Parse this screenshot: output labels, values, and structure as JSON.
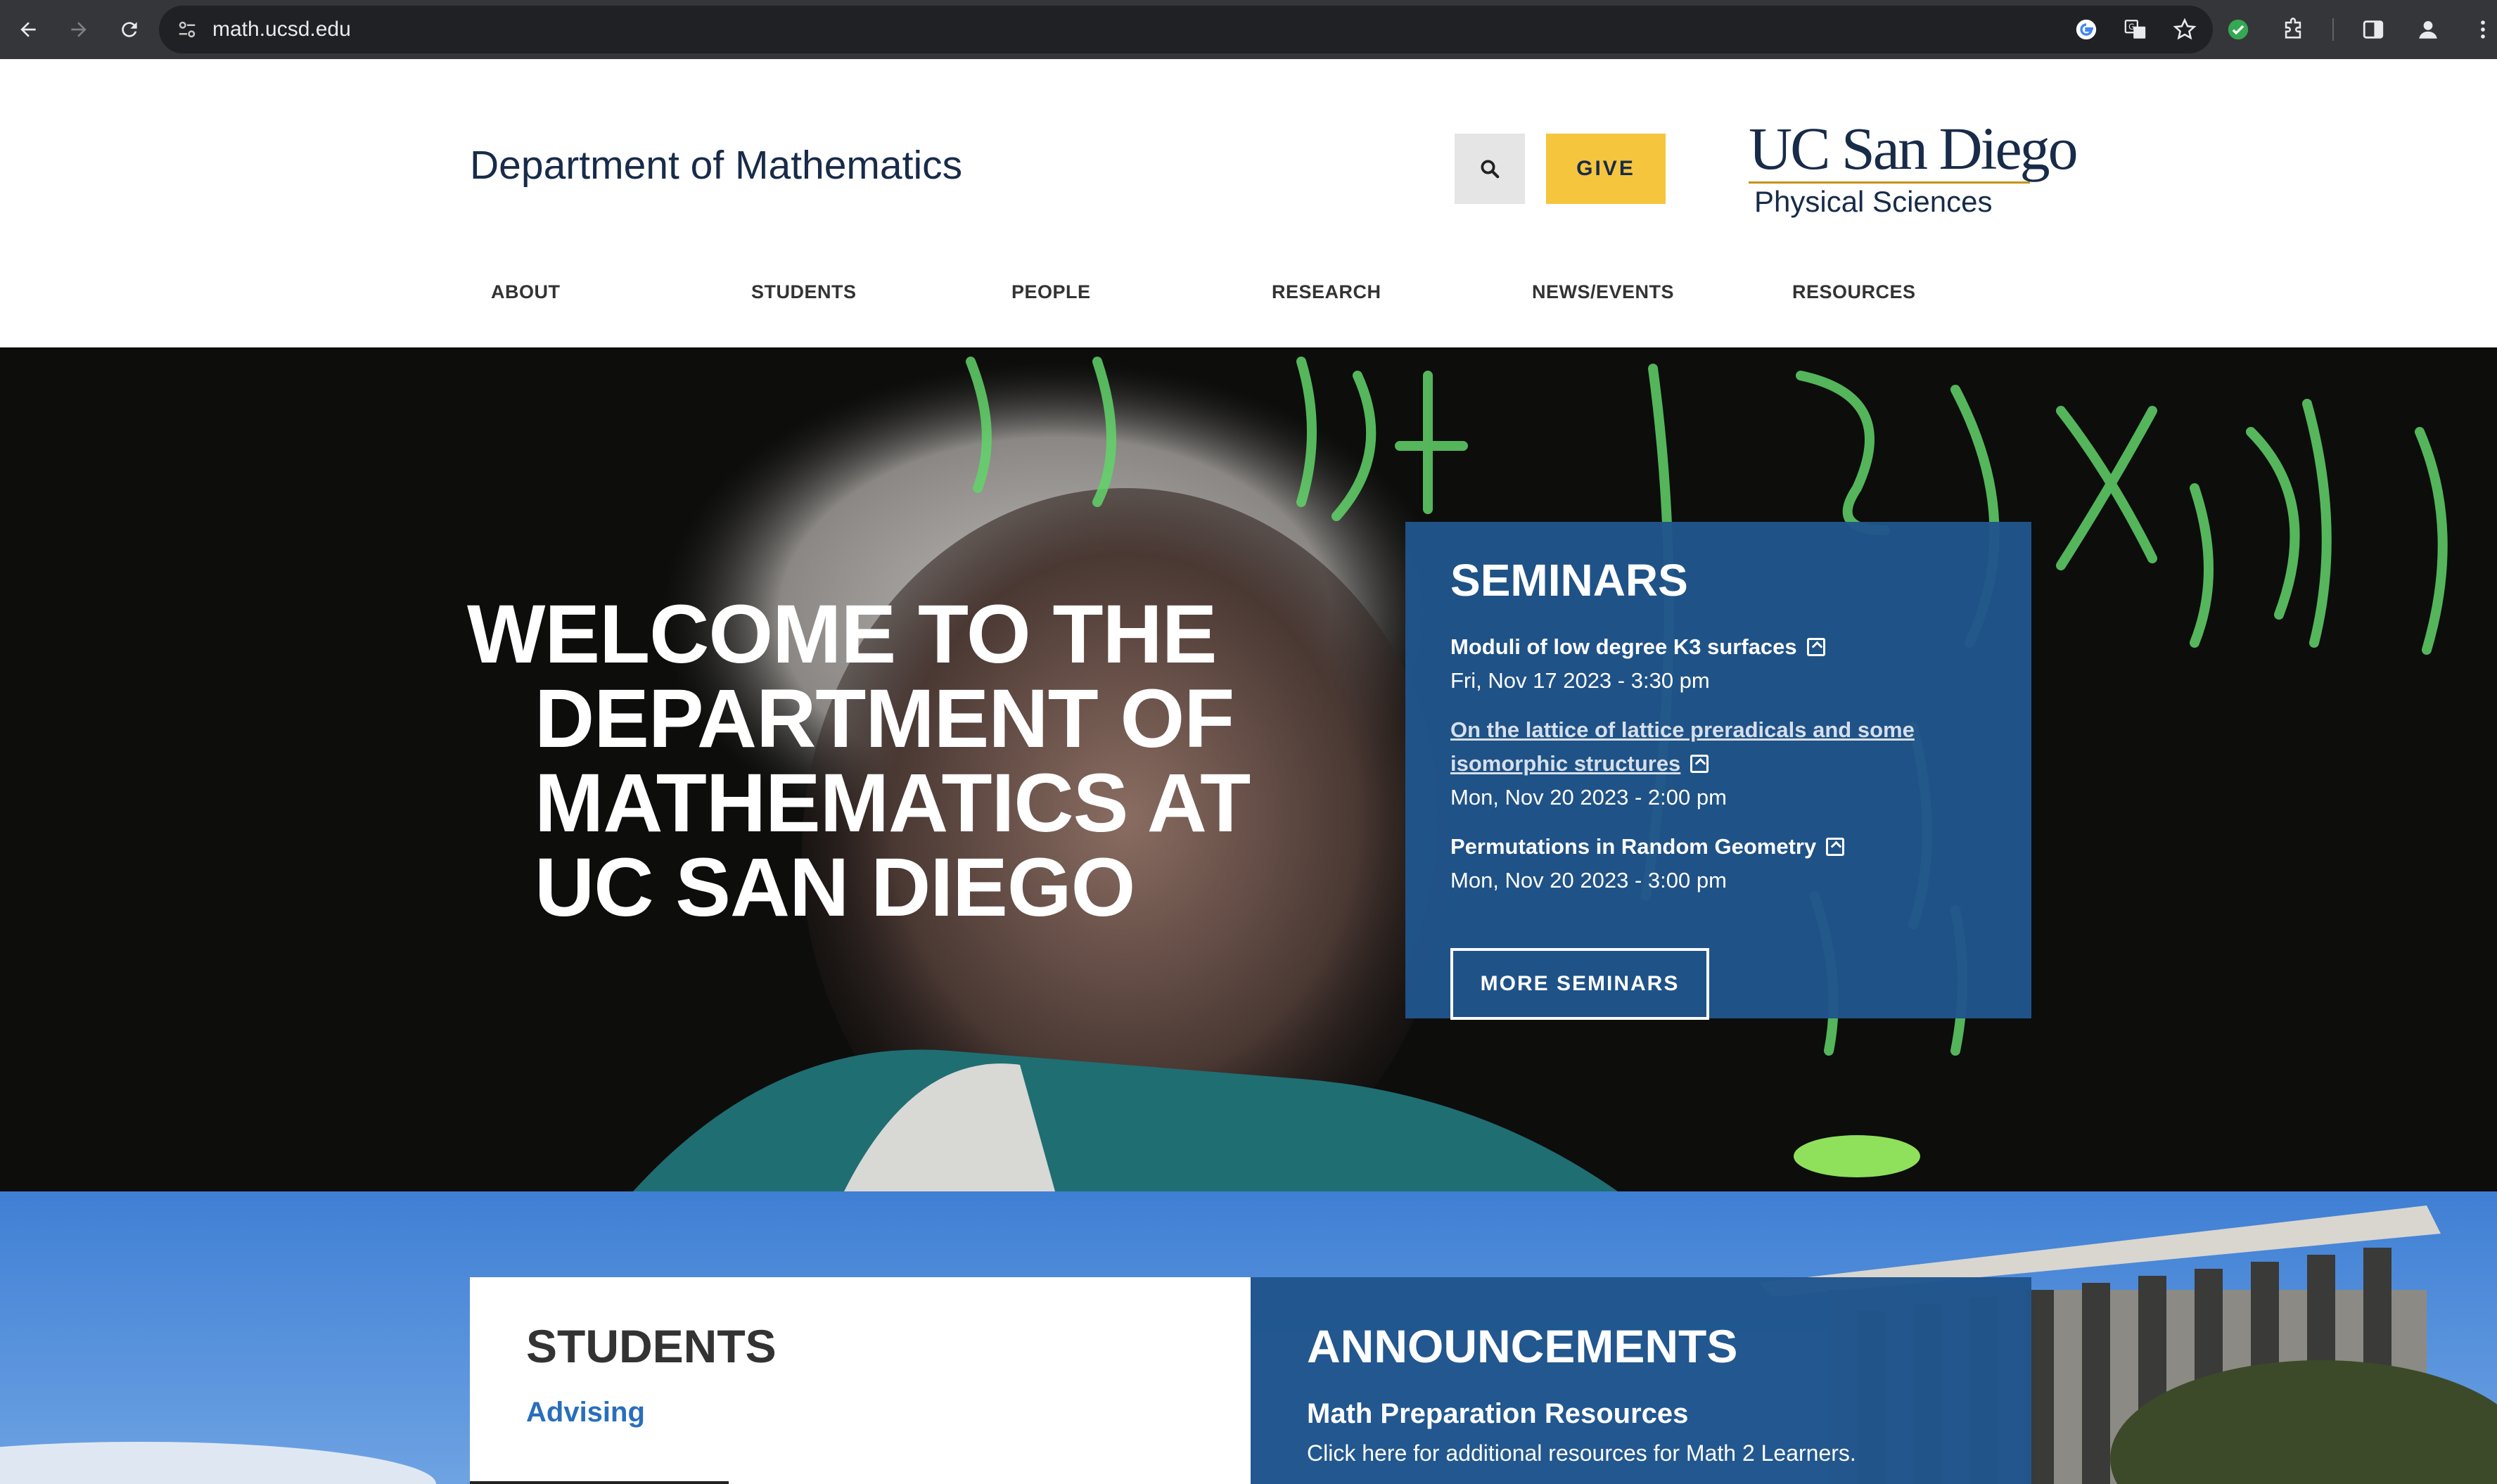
{
  "browser": {
    "url": "math.ucsd.edu",
    "back_icon": "arrow-left-icon",
    "forward_icon": "arrow-right-icon",
    "reload_icon": "reload-icon"
  },
  "header": {
    "dept_title": "Department of Mathematics",
    "give_label": "GIVE",
    "logo_line1": "UC San Diego",
    "logo_line2": "Physical Sciences"
  },
  "nav": {
    "items": [
      {
        "label": "ABOUT"
      },
      {
        "label": "STUDENTS"
      },
      {
        "label": "PEOPLE"
      },
      {
        "label": "RESEARCH"
      },
      {
        "label": "NEWS/EVENTS"
      },
      {
        "label": "RESOURCES"
      }
    ]
  },
  "hero": {
    "welcome_line1": "WELCOME TO THE",
    "welcome_line2": "DEPARTMENT OF",
    "welcome_line3": "MATHEMATICS AT",
    "welcome_line4": "UC SAN DIEGO"
  },
  "seminars": {
    "heading": "SEMINARS",
    "items": [
      {
        "title": "Moduli of low degree K3 surfaces",
        "date": "Fri, Nov 17 2023 - 3:30 pm"
      },
      {
        "title": "On the lattice of lattice preradicals and some isomorphic structures",
        "date": "Mon, Nov 20 2023 - 2:00 pm"
      },
      {
        "title": "Permutations in Random Geometry",
        "date": "Mon, Nov 20 2023 - 3:00 pm"
      }
    ],
    "more_label": "MORE SEMINARS"
  },
  "students": {
    "heading": "STUDENTS",
    "link": "Advising"
  },
  "announcements": {
    "heading": "ANNOUNCEMENTS",
    "title": "Math Preparation Resources",
    "text": "Click here for additional resources for Math 2 Learners."
  },
  "colors": {
    "navy": "#182b49",
    "gold": "#f5c53d",
    "seminar_blue": "#20558c",
    "link_blue": "#2a6ebb"
  }
}
